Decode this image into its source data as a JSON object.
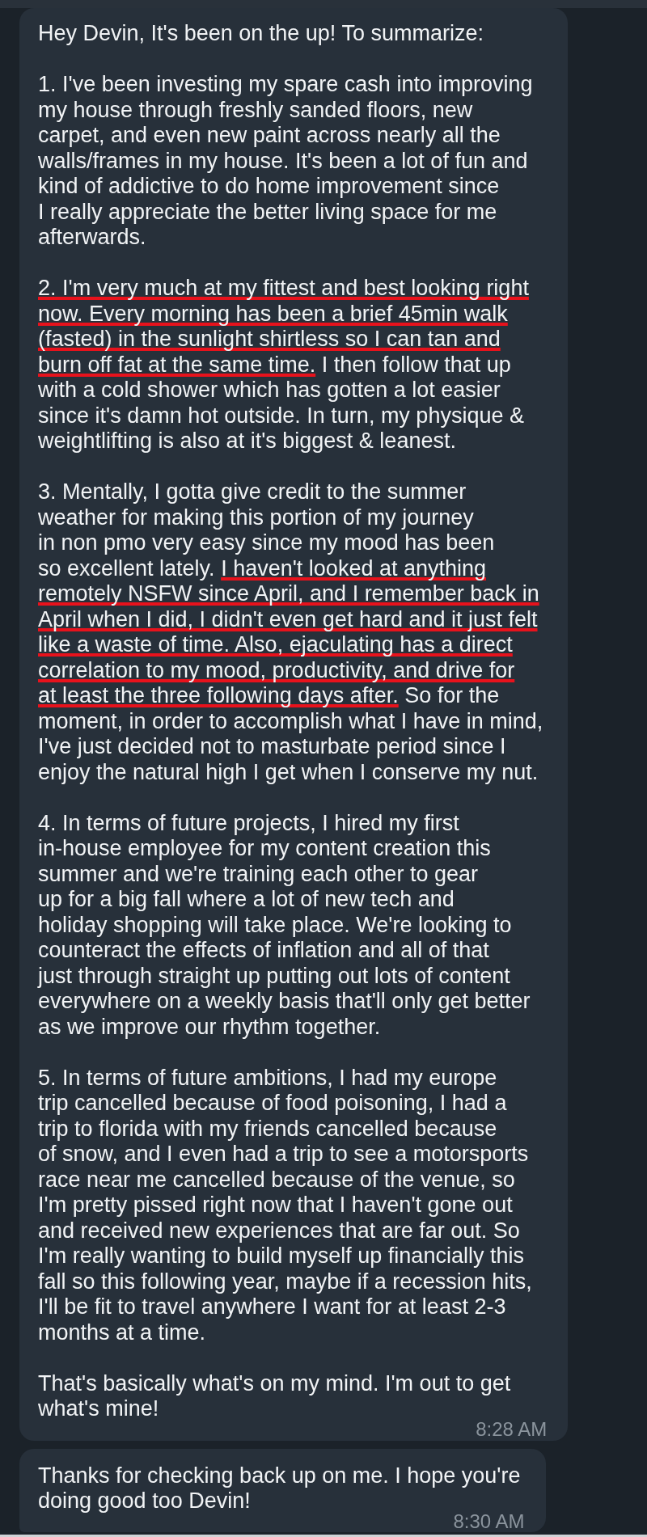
{
  "chat": {
    "messages": [
      {
        "paragraphs": [
          {
            "segments": [
              {
                "text": "Hey Devin, It's been on the up! To summarize:",
                "underlined": false
              }
            ]
          },
          {
            "segments": [
              {
                "text": "1. I've been investing my spare cash into improving\nmy house through freshly sanded floors, new\ncarpet, and even new paint across nearly all the\nwalls/frames in my house. It's been a lot of fun and\nkind of addictive to do home improvement since\nI really appreciate the better living space for me\nafterwards.",
                "underlined": false
              }
            ]
          },
          {
            "segments": [
              {
                "text": "2. I'm very much at my fittest and best looking right\nnow. Every morning has been a brief 45min walk\n(fasted) in the sunlight shirtless so I can tan and\nburn off fat at the same time.",
                "underlined": true
              },
              {
                "text": " I then follow that up\nwith a cold shower which has gotten a lot easier\nsince it's damn hot outside. In turn, my physique &\nweightlifting is also at it's biggest & leanest.",
                "underlined": false
              }
            ]
          },
          {
            "segments": [
              {
                "text": "3. Mentally, I gotta give credit to the summer\nweather for making this portion of my journey\nin non pmo very easy since my mood has been\nso excellent lately. ",
                "underlined": false
              },
              {
                "text": "I haven't looked at anything\nremotely NSFW since April, and I remember back in\nApril when I did, I didn't even get hard and it just felt\nlike a waste of time. Also, ejaculating has a direct\ncorrelation to my mood, productivity, and drive for\nat least the three following days after.",
                "underlined": true
              },
              {
                "text": " So for the\nmoment, in order to accomplish what I have in mind,\nI've just decided not to masturbate period since I\nenjoy the natural high I get when I conserve my nut.",
                "underlined": false
              }
            ]
          },
          {
            "segments": [
              {
                "text": "4. In terms of future projects, I hired my first\nin-house employee for my content creation this\nsummer and we're training each other to gear\nup for a big fall where a lot of new tech and\nholiday shopping will take place. We're looking to\ncounteract the effects of inflation and all of that\njust through straight up putting out lots of content\neverywhere on a weekly basis that'll only get better\nas we improve our rhythm together.",
                "underlined": false
              }
            ]
          },
          {
            "segments": [
              {
                "text": "5. In terms of future ambitions, I had my europe\ntrip cancelled because of food poisoning, I had a\ntrip to florida with my friends cancelled because\nof snow, and I even had a trip to see a motorsports\nrace near me cancelled because of the venue, so\nI'm pretty pissed right now that I haven't gone out\nand received new experiences that are far out. So\nI'm really wanting to build myself up financially this\nfall so this following year, maybe if a recession hits,\nI'll be fit to travel anywhere I want for at least 2-3\nmonths at a time.",
                "underlined": false
              }
            ]
          },
          {
            "segments": [
              {
                "text": "That's basically what's on my mind. I'm out to get\nwhat's mine!",
                "underlined": false
              }
            ]
          }
        ],
        "time": "8:28 AM"
      },
      {
        "paragraphs": [
          {
            "segments": [
              {
                "text": "Thanks for checking back up on me. I hope you're\ndoing good too Devin!",
                "underlined": false
              }
            ]
          }
        ],
        "time": "8:30 AM"
      }
    ]
  }
}
